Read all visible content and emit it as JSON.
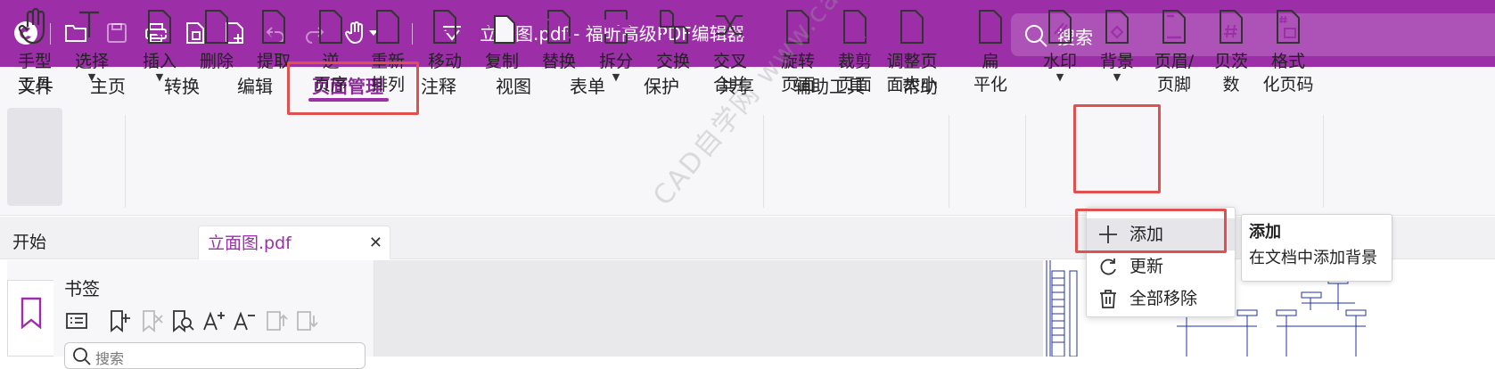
{
  "app": {
    "title": "立面图.pdf - 福昕高级PDF编辑器",
    "search_placeholder": "搜索",
    "brand_color": "#9c2ea8",
    "highlight_color": "#e0504f"
  },
  "menu": [
    {
      "label": "文件"
    },
    {
      "label": "主页"
    },
    {
      "label": "转换"
    },
    {
      "label": "编辑"
    },
    {
      "label": "页面管理",
      "active": true
    },
    {
      "label": "注释"
    },
    {
      "label": "视图"
    },
    {
      "label": "表单"
    },
    {
      "label": "保护"
    },
    {
      "label": "共享"
    },
    {
      "label": "辅助工具"
    },
    {
      "label": "帮助"
    }
  ],
  "ribbon": {
    "hand": {
      "line1": "手型",
      "line2": "工具"
    },
    "select": {
      "line1": "选择"
    },
    "insert": {
      "line1": "插入"
    },
    "delete": {
      "line1": "删除"
    },
    "extract": {
      "line1": "提取"
    },
    "reverse": {
      "line1": "逆",
      "line2": "页序"
    },
    "reorder": {
      "line1": "重新",
      "line2": "排列"
    },
    "move": {
      "line1": "移动"
    },
    "copy": {
      "line1": "复制"
    },
    "replace": {
      "line1": "替换"
    },
    "split": {
      "line1": "拆分"
    },
    "swap": {
      "line1": "交换"
    },
    "interleave": {
      "line1": "交叉",
      "line2": "合并"
    },
    "rotate": {
      "line1": "旋转",
      "line2": "页面"
    },
    "crop": {
      "line1": "裁剪",
      "line2": "页面"
    },
    "resize": {
      "line1": "调整页",
      "line2": "面大小"
    },
    "flatten": {
      "line1": "扁",
      "line2": "平化"
    },
    "watermark": {
      "line1": "水印"
    },
    "background": {
      "line1": "背景"
    },
    "header_footer": {
      "line1": "页眉/",
      "line2": "页脚"
    },
    "bates": {
      "line1": "贝茨",
      "line2": "数"
    },
    "format_page_no": {
      "line1": "格式",
      "line2": "化页码"
    }
  },
  "tabs": [
    {
      "label": "开始"
    },
    {
      "label": "立面图.pdf"
    }
  ],
  "bookmarks": {
    "title": "书签",
    "search_placeholder": "搜索"
  },
  "background_menu": {
    "items": [
      {
        "label": "添加",
        "icon": "plus-icon"
      },
      {
        "label": "更新",
        "icon": "refresh-icon"
      },
      {
        "label": "全部移除",
        "icon": "trash-icon"
      }
    ]
  },
  "tooltip": {
    "title": "添加",
    "description": "在文档中添加背景"
  },
  "watermark_text": "CAD自学网 www.cadzxw.com"
}
